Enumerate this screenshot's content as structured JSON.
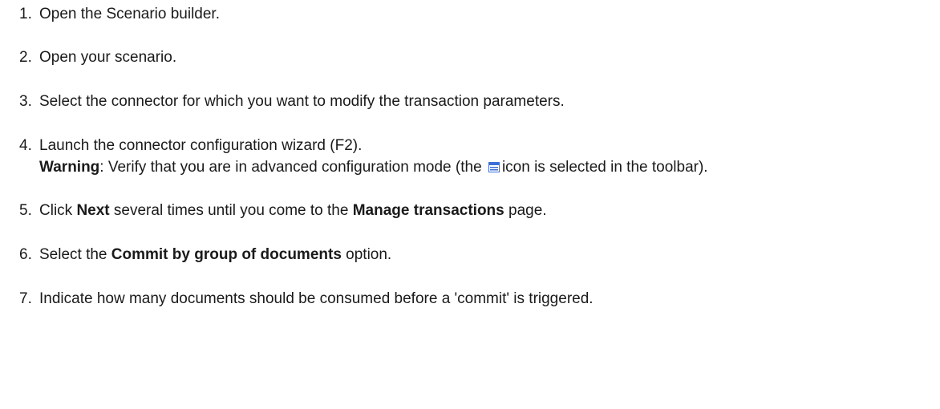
{
  "steps": [
    {
      "num": "1.",
      "text": "Open the Scenario builder."
    },
    {
      "num": "2.",
      "text": "Open your scenario."
    },
    {
      "num": "3.",
      "text": "Select the connector for which you want to modify the transaction parameters."
    },
    {
      "num": "4.",
      "text": "Launch the connector configuration wizard (F2).",
      "warning_label": "Warning",
      "warning_before_icon": ": Verify that you are in advanced configuration mode (the",
      "warning_after_icon": "icon is selected in the toolbar).",
      "icon": "advanced-mode-icon"
    },
    {
      "num": "5.",
      "pre": "Click ",
      "b1": "Next",
      "mid": " several times until you come to the ",
      "b2": "Manage transactions",
      "post": " page."
    },
    {
      "num": "6.",
      "pre": "Select the ",
      "b1": "Commit by group of documents",
      "post": " option."
    },
    {
      "num": "7.",
      "text": "Indicate how many documents should be consumed before a 'commit' is triggered."
    }
  ],
  "colors": {
    "text": "#1a1a1a",
    "icon_blue": "#3b6fd6"
  }
}
